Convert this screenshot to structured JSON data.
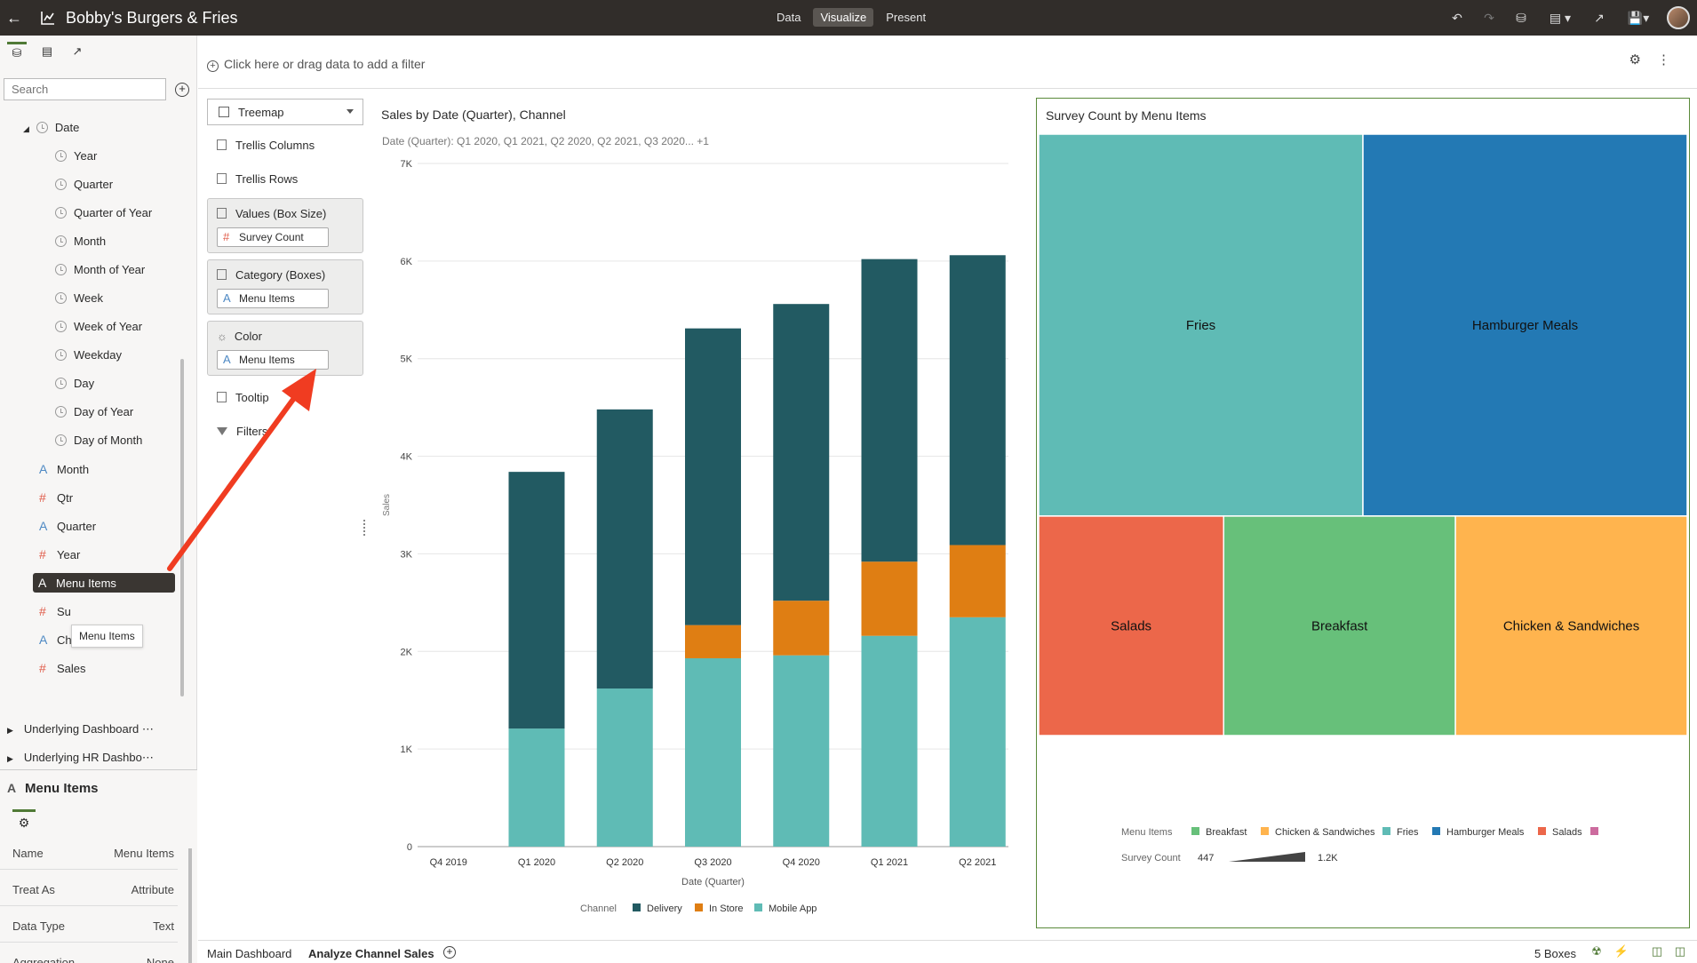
{
  "app": {
    "title": "Bobby's Burgers & Fries"
  },
  "modes": [
    "Data",
    "Visualize",
    "Present"
  ],
  "search": {
    "placeholder": "Search"
  },
  "tree": {
    "date_folder": "Date",
    "date_items": [
      "Year",
      "Quarter",
      "Quarter of Year",
      "Month",
      "Month of Year",
      "Week",
      "Week of Year",
      "Weekday",
      "Day",
      "Day of Year",
      "Day of Month"
    ],
    "fields": [
      {
        "label": "Month",
        "kind": "attribute"
      },
      {
        "label": "Qtr",
        "kind": "measure"
      },
      {
        "label": "Quarter",
        "kind": "attribute"
      },
      {
        "label": "Year",
        "kind": "measure"
      },
      {
        "label": "Menu Items",
        "kind": "attribute"
      },
      {
        "label": "Su",
        "kind": "measure"
      },
      {
        "label": "Channel",
        "kind": "attribute"
      },
      {
        "label": "Sales",
        "kind": "measure"
      }
    ],
    "datasets": [
      "Underlying Dashboard",
      "Underlying HR Dashbo"
    ],
    "more": "⋯",
    "tooltip": "Menu Items"
  },
  "properties": {
    "title": "Menu Items",
    "rows": [
      {
        "key": "Name",
        "value": "Menu Items"
      },
      {
        "key": "Treat As",
        "value": "Attribute"
      },
      {
        "key": "Data Type",
        "value": "Text"
      },
      {
        "key": "Aggregation",
        "value": "None"
      }
    ]
  },
  "filterbar": {
    "prompt": "Click here or drag data to add a filter"
  },
  "grammar": {
    "viz_type": "Treemap",
    "trellis_columns": "Trellis Columns",
    "trellis_rows": "Trellis Rows",
    "values_label": "Values (Box Size)",
    "values_pill": "Survey Count",
    "category_label": "Category (Boxes)",
    "category_pill": "Menu Items",
    "color_label": "Color",
    "color_pill": "Menu Items",
    "tooltip": "Tooltip",
    "filters": "Filters"
  },
  "colors": {
    "delivery": "#225a62",
    "in_store": "#df7e13",
    "mobile_app": "#5fbbb5",
    "fries": "#5fbbb5",
    "hamburger": "#2379b4",
    "salads": "#ec674a",
    "breakfast": "#67c07a",
    "chicken": "#ffb44e",
    "extra": "#cc6b9e",
    "annotation": "#f03c21",
    "accent": "#507a36"
  },
  "chart_data": [
    {
      "type": "bar",
      "stacked": true,
      "title": "Sales by Date (Quarter), Channel",
      "subtitle_label": "Date (Quarter):",
      "subtitle_value": "Q1 2020, Q1 2021, Q2 2020, Q2 2021, Q3 2020... +1",
      "xlabel": "Date (Quarter)",
      "ylabel": "Sales",
      "x_ticks": [
        "Q4 2019",
        "Q1 2020",
        "Q2 2020",
        "Q3 2020",
        "Q4 2020",
        "Q1 2021",
        "Q2 2021"
      ],
      "categories": [
        "Q1 2020",
        "Q2 2020",
        "Q3 2020",
        "Q4 2020",
        "Q1 2021",
        "Q2 2021"
      ],
      "y_ticks": [
        "0",
        "1K",
        "2K",
        "3K",
        "4K",
        "5K",
        "6K",
        "7K"
      ],
      "ylim": [
        0,
        7000
      ],
      "grid": true,
      "legend_title": "Channel",
      "legend_position": "bottom",
      "series": [
        {
          "name": "Mobile App",
          "values": [
            1210,
            1620,
            1930,
            1960,
            2160,
            2350
          ]
        },
        {
          "name": "In Store",
          "values": [
            0,
            0,
            340,
            560,
            760,
            740
          ]
        },
        {
          "name": "Delivery",
          "values": [
            2630,
            2860,
            3040,
            3040,
            3100,
            2970
          ]
        }
      ]
    },
    {
      "type": "treemap",
      "title": "Survey Count by Menu Items",
      "legend_title": "Menu Items",
      "legend_position": "bottom",
      "items": [
        {
          "name": "Fries",
          "value": 1200
        },
        {
          "name": "Hamburger Meals",
          "value": 1200
        },
        {
          "name": "Salads",
          "value": 447
        },
        {
          "name": "Breakfast",
          "value": 560
        },
        {
          "name": "Chicken & Sandwiches",
          "value": 560
        }
      ],
      "legend_items": [
        "Breakfast",
        "Chicken & Sandwiches",
        "Fries",
        "Hamburger Meals",
        "Salads"
      ],
      "size_legend": {
        "label": "Survey Count",
        "min": "447",
        "max": "1.2K"
      }
    }
  ],
  "bottom": {
    "tabs": [
      "Main Dashboard",
      "Analyze Channel Sales"
    ],
    "status": "5 Boxes"
  }
}
